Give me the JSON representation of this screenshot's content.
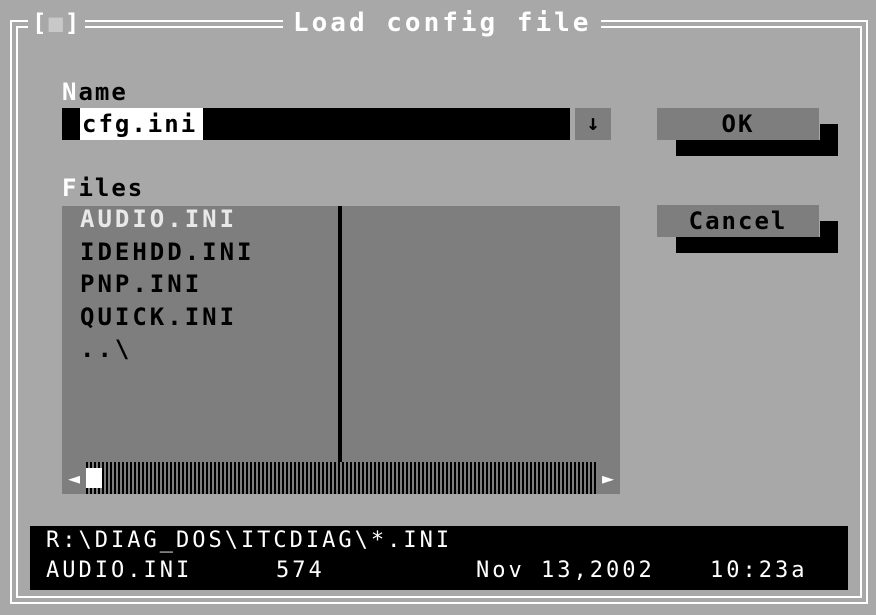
{
  "dialog": {
    "title": "Load config file",
    "close_left": "[",
    "close_glyph": "■",
    "close_right": "]"
  },
  "name_field": {
    "label_hot": "N",
    "label_rest": "ame",
    "value": "cfg.ini",
    "dropdown_glyph": "↓"
  },
  "buttons": {
    "ok": "OK",
    "cancel": "Cancel"
  },
  "files": {
    "label_hot": "F",
    "label_rest": "iles",
    "items": [
      "AUDIO.INI",
      "IDEHDD.INI",
      "PNP.INI",
      "QUICK.INI",
      "..\\"
    ],
    "selected_index": 0,
    "scroll_left": "◄",
    "scroll_right": "►"
  },
  "status": {
    "path": "R:\\DIAG_DOS\\ITCDIAG\\*.INI",
    "file_name": "AUDIO.INI",
    "file_size": "574",
    "file_date": "Nov 13,2002",
    "file_time": "10:23a"
  },
  "colors": {
    "background": "#a8a8a8",
    "control": "#7e7e7e",
    "text": "#000000",
    "highlight": "#ffffff"
  }
}
